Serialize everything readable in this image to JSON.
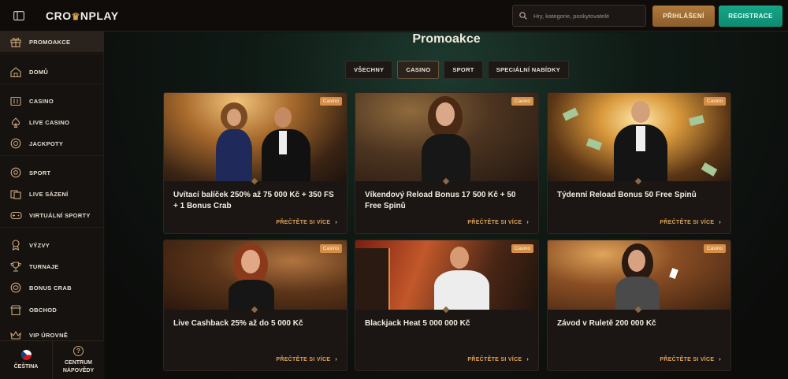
{
  "header": {
    "logo_text": "CROWNPLAY",
    "logo_left": "CRO",
    "logo_right": "NPLAY",
    "search_placeholder": "Hry, kategorie, poskytovatelé",
    "login_label": "PŘIHLÁŠENÍ",
    "register_label": "REGISTRACE"
  },
  "sidebar": {
    "items": [
      {
        "label": "PROMOAKCE",
        "icon": "gift-icon",
        "active": true
      },
      {
        "label": "DOMŮ",
        "icon": "home-icon"
      },
      {
        "label": "CASINO",
        "icon": "slot-icon"
      },
      {
        "label": "LIVE CASINO",
        "icon": "spade-icon"
      },
      {
        "label": "JACKPOTY",
        "icon": "coin-icon"
      },
      {
        "label": "SPORT",
        "icon": "ball-icon"
      },
      {
        "label": "LIVE SÁZENÍ",
        "icon": "live-bet-icon"
      },
      {
        "label": "VIRTUÁLNÍ SPORTY",
        "icon": "gamepad-icon"
      },
      {
        "label": "VÝZVY",
        "icon": "medal-icon"
      },
      {
        "label": "TURNAJE",
        "icon": "trophy-icon"
      },
      {
        "label": "BONUS CRAB",
        "icon": "crab-icon"
      },
      {
        "label": "OBCHOD",
        "icon": "shop-icon"
      },
      {
        "label": "VIP ÚROVNĚ",
        "icon": "vip-icon"
      }
    ],
    "language_label": "ČEŠTINA",
    "help_label_1": "CENTRUM",
    "help_label_2": "NÁPOVĚDY"
  },
  "main": {
    "title": "Promoakce",
    "tabs": [
      {
        "label": "VŠECHNY",
        "active": false
      },
      {
        "label": "CASINO",
        "active": true
      },
      {
        "label": "SPORT",
        "active": false
      },
      {
        "label": "SPECIÁLNÍ NABÍDKY",
        "active": false
      }
    ],
    "read_more": "PŘEČTĚTE SI VÍCE",
    "cards": [
      {
        "badge": "Casino",
        "title": "Uvítací balíček 250% až 75 000 Kč + 350 FS + 1 Bonus Crab"
      },
      {
        "badge": "Casino",
        "title": "Víkendový Reload Bonus 17 500 Kč + 50 Free Spinů"
      },
      {
        "badge": "Casino",
        "title": "Týdenní Reload Bonus 50 Free Spinů"
      },
      {
        "badge": "Casino",
        "title": "Live Cashback 25% až do 5 000 Kč"
      },
      {
        "badge": "Casino",
        "title": "Blackjack Heat 5 000 000 Kč"
      },
      {
        "badge": "Casino",
        "title": "Závod v Ruletě 200 000 Kč"
      }
    ]
  }
}
